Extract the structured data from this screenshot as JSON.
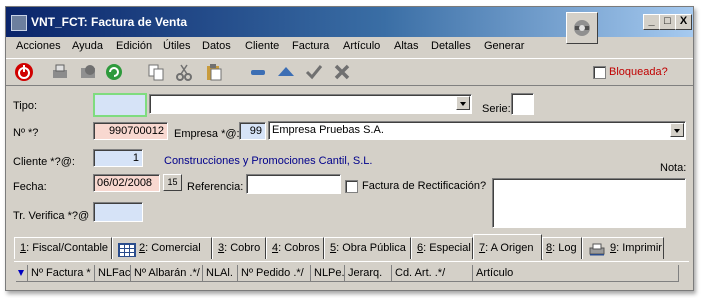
{
  "window": {
    "title": "VNT_FCT: Factura de Venta",
    "controls": [
      "_",
      "□",
      "X"
    ]
  },
  "menu": [
    "Acciones",
    "Ayuda",
    "Edición",
    "Útiles",
    "Datos",
    "Cliente",
    "Factura",
    "Artículo",
    "Altas",
    "Detalles",
    "Generar"
  ],
  "toolbar": {
    "blocked_label": "Bloqueada?"
  },
  "form": {
    "tipo_label": "Tipo:",
    "tipo_code": "",
    "tipo_value": "",
    "serie_label": "Serie:",
    "serie_value": "",
    "num_label": "Nº *?",
    "num_value": "990700012",
    "empresa_label": "Empresa *@:",
    "empresa_code": "99",
    "empresa_name": "Empresa Pruebas S.A.",
    "cliente_label": "Cliente *?@:",
    "cliente_code": "1",
    "cliente_name": "Construcciones y Promociones Cantil, S.L.",
    "nota_label": "Nota:",
    "fecha_label": "Fecha:",
    "fecha_value": "06/02/2008",
    "fecha_btn": "15",
    "referencia_label": "Referencia:",
    "referencia_value": "",
    "rectificacion_label": "Factura de Rectificación?",
    "tr_label": "Tr. Verifica *?@",
    "tr_value": ""
  },
  "tabs": [
    {
      "key": "1",
      "label": ": Fiscal/Contable"
    },
    {
      "key": "2",
      "label": ": Comercial"
    },
    {
      "key": "3",
      "label": ": Cobro"
    },
    {
      "key": "4",
      "label": ": Cobros"
    },
    {
      "key": "5",
      "label": ": Obra Pública"
    },
    {
      "key": "6",
      "label": ": Especial"
    },
    {
      "key": "7",
      "label": ": A Origen"
    },
    {
      "key": "8",
      "label": ": Log"
    },
    {
      "key": "9",
      "label": ": Imprimir"
    }
  ],
  "active_tab": "7",
  "grid_columns": [
    "Nº Factura *",
    "NLFac",
    "Nº Albarán .*/",
    "NLAl.",
    "Nº Pedido .*/",
    "NLPe.",
    "Jerarq.",
    "Cd. Art. .*/",
    "Artículo"
  ],
  "colors": {
    "titlebar_start": "#0a246a",
    "titlebar_end": "#a6caf0",
    "required_field": "#d6e3f7",
    "key_field": "#f8d8d0",
    "link_text": "#00008b",
    "blocked_text": "#c00000"
  },
  "icons": [
    "power-icon",
    "print-icon",
    "preview-icon",
    "refresh-icon",
    "copy-icon",
    "cut-icon",
    "paste-icon",
    "minus-icon",
    "triangle-icon",
    "check-icon",
    "delete-icon",
    "calendar-icon",
    "grid-icon",
    "printer-icon"
  ]
}
